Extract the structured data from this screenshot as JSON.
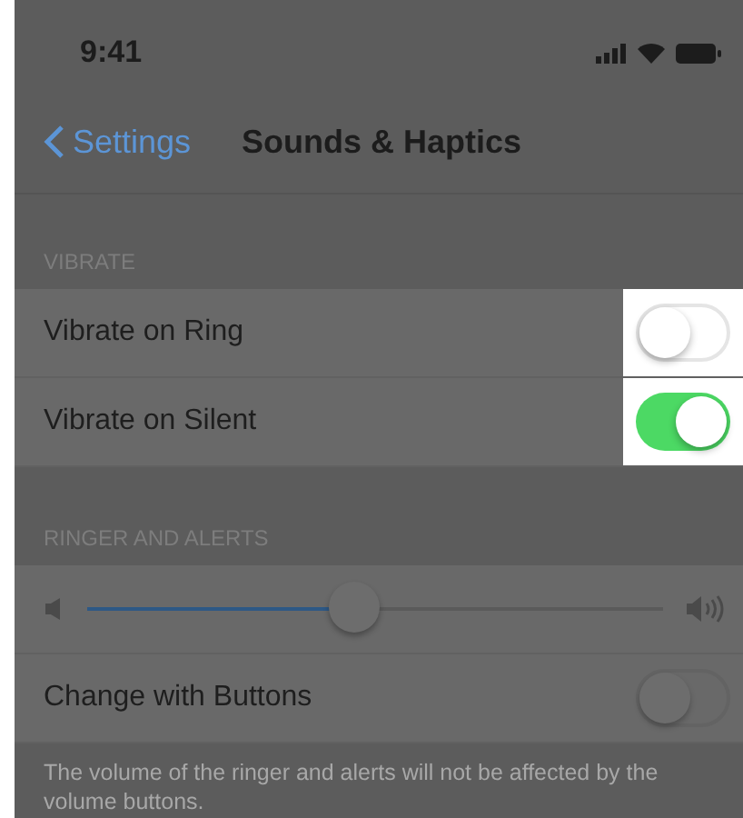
{
  "status_bar": {
    "time": "9:41"
  },
  "nav": {
    "back": "Settings",
    "title": "Sounds & Haptics"
  },
  "sections": [
    {
      "header": "VIBRATE",
      "rows": [
        {
          "kind": "toggle",
          "label": "Vibrate on Ring",
          "on": false,
          "highlighted": true
        },
        {
          "kind": "toggle",
          "label": "Vibrate on Silent",
          "on": true,
          "highlighted": true
        }
      ]
    },
    {
      "header": "RINGER AND ALERTS",
      "rows": [
        {
          "kind": "slider",
          "level": 0.46
        },
        {
          "kind": "toggle",
          "label": "Change with Buttons",
          "on": false,
          "highlighted": false
        }
      ],
      "footer": "The volume of the ringer and alerts will not be affected by the volume buttons."
    }
  ]
}
